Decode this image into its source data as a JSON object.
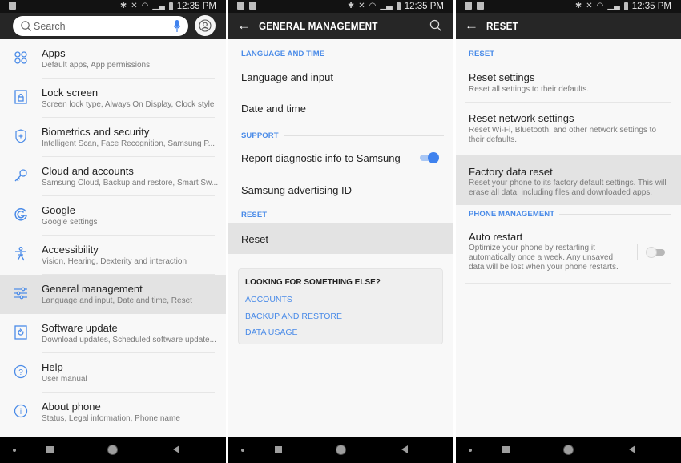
{
  "status_bar": {
    "time": "12:35 PM",
    "icons": [
      "bluetooth-icon",
      "mute-icon",
      "wifi-icon",
      "signal-icon",
      "battery-icon"
    ]
  },
  "panel1": {
    "search": {
      "placeholder": "Search"
    },
    "items": [
      {
        "icon": "apps-icon",
        "title": "Apps",
        "subtitle": "Default apps, App permissions"
      },
      {
        "icon": "lock-icon",
        "title": "Lock screen",
        "subtitle": "Screen lock type, Always On Display, Clock style"
      },
      {
        "icon": "shield-icon",
        "title": "Biometrics and security",
        "subtitle": "Intelligent Scan, Face Recognition, Samsung P..."
      },
      {
        "icon": "key-icon",
        "title": "Cloud and accounts",
        "subtitle": "Samsung Cloud, Backup and restore, Smart Sw..."
      },
      {
        "icon": "google-icon",
        "title": "Google",
        "subtitle": "Google settings"
      },
      {
        "icon": "accessibility-icon",
        "title": "Accessibility",
        "subtitle": "Vision, Hearing, Dexterity and interaction"
      },
      {
        "icon": "sliders-icon",
        "title": "General management",
        "subtitle": "Language and input, Date and time, Reset",
        "selected": true
      },
      {
        "icon": "software-update-icon",
        "title": "Software update",
        "subtitle": "Download updates, Scheduled software update..."
      },
      {
        "icon": "help-icon",
        "title": "Help",
        "subtitle": "User manual"
      },
      {
        "icon": "info-icon",
        "title": "About phone",
        "subtitle": "Status, Legal information, Phone name"
      }
    ]
  },
  "panel2": {
    "title": "GENERAL MANAGEMENT",
    "sections": {
      "language": "LANGUAGE AND TIME",
      "support": "SUPPORT",
      "reset": "RESET"
    },
    "rows": {
      "language_input": "Language and input",
      "date_time": "Date and time",
      "report_diag": "Report diagnostic info to Samsung",
      "report_diag_enabled": true,
      "advertising_id": "Samsung advertising ID",
      "reset": "Reset"
    },
    "card": {
      "heading": "LOOKING FOR SOMETHING ELSE?",
      "links": [
        "ACCOUNTS",
        "BACKUP AND RESTORE",
        "DATA USAGE"
      ]
    }
  },
  "panel3": {
    "title": "RESET",
    "sections": {
      "reset": "RESET",
      "phone_mgmt": "PHONE MANAGEMENT"
    },
    "rows": {
      "reset_settings": {
        "title": "Reset settings",
        "subtitle": "Reset all settings to their defaults."
      },
      "reset_network": {
        "title": "Reset network settings",
        "subtitle": "Reset Wi-Fi, Bluetooth, and other network settings to their defaults."
      },
      "factory_reset": {
        "title": "Factory data reset",
        "subtitle": "Reset your phone to its factory default settings. This will erase all data, including files and downloaded apps."
      },
      "auto_restart": {
        "title": "Auto restart",
        "subtitle": "Optimize your phone by restarting it automatically once a week. Any unsaved data will be lost when your phone restarts.",
        "enabled": false
      }
    }
  },
  "colors": {
    "accent": "#4a8be8",
    "toggle_on": "#3f82ee",
    "appbar": "#262626",
    "selected_row": "#e3e3e3"
  }
}
